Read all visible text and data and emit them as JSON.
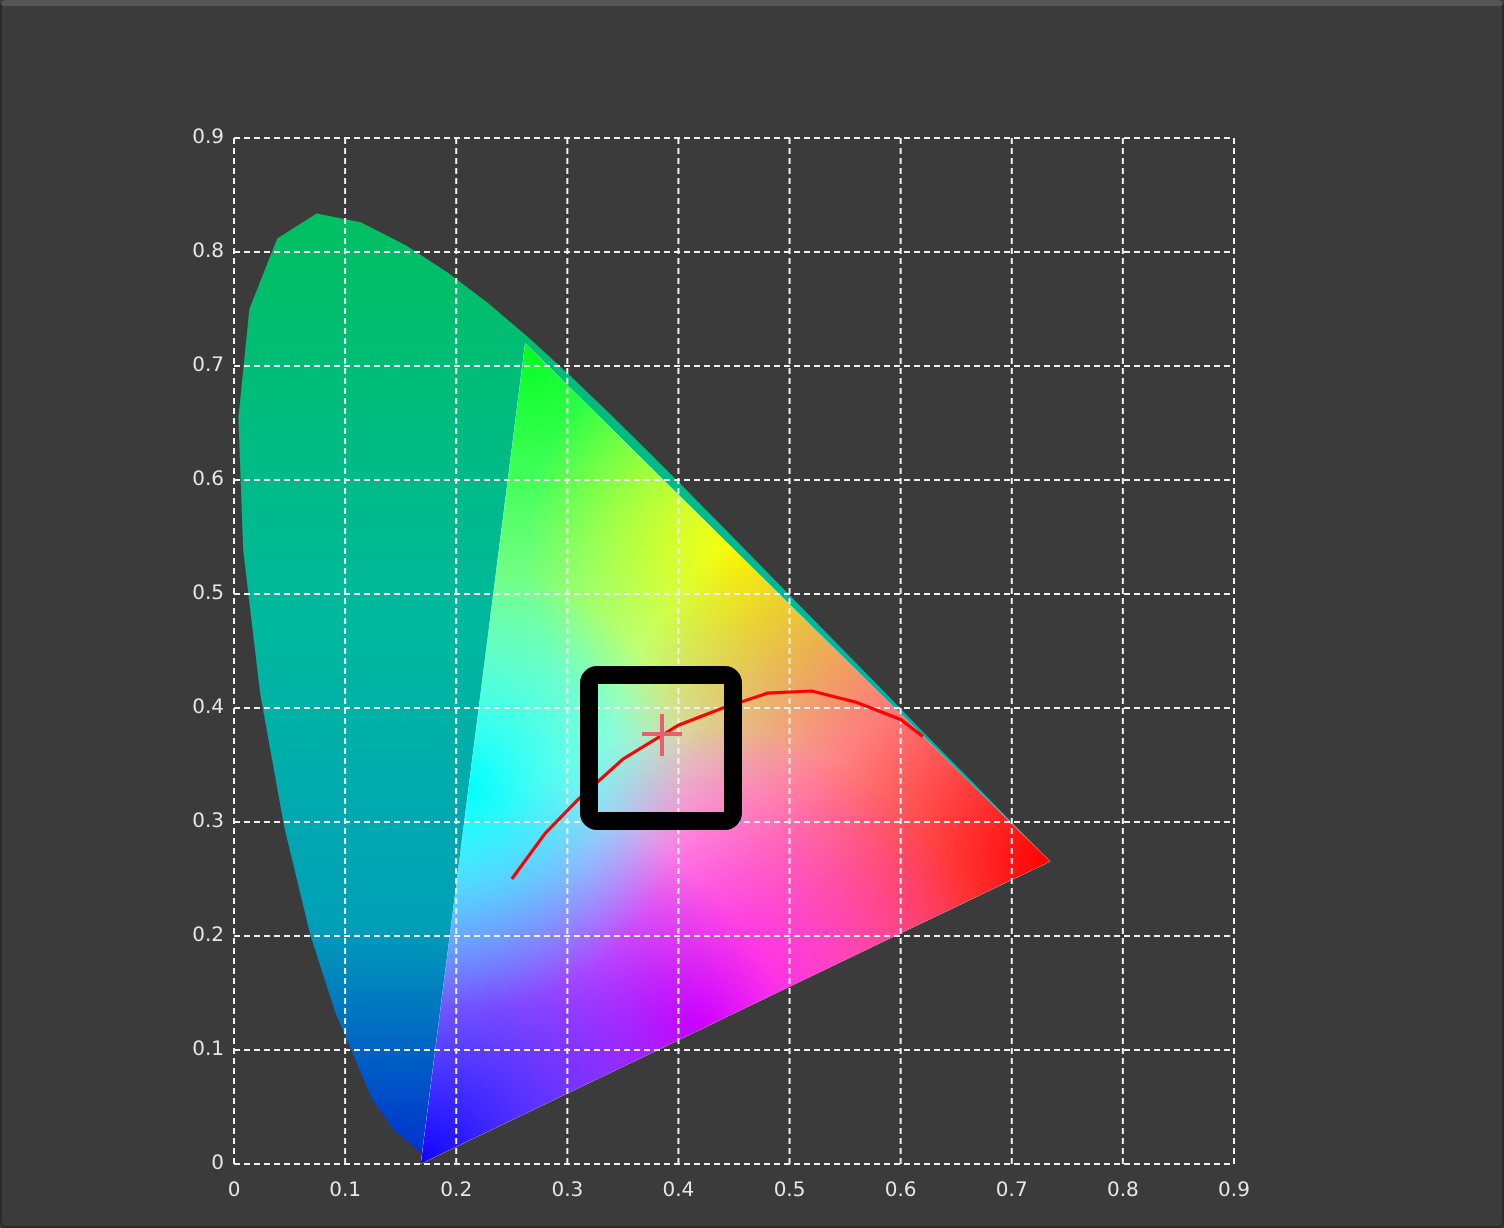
{
  "plot": {
    "chart_data": {
      "type": "line",
      "xlim": [
        0,
        0.9
      ],
      "ylim": [
        0,
        0.9
      ],
      "grid": true,
      "xticks": [
        0,
        0.1,
        0.2,
        0.3,
        0.4,
        0.5,
        0.6,
        0.7,
        0.8,
        0.9
      ],
      "yticks": [
        0,
        0.1,
        0.2,
        0.3,
        0.4,
        0.5,
        0.6,
        0.7,
        0.8,
        0.9
      ],
      "x": [
        0.25,
        0.28,
        0.31,
        0.35,
        0.4,
        0.44,
        0.48,
        0.52,
        0.56,
        0.6,
        0.62
      ],
      "series": [
        {
          "color": "#ff0000",
          "values": [
            0.25,
            0.29,
            0.32,
            0.355,
            0.385,
            0.4,
            0.413,
            0.415,
            0.405,
            0.39,
            0.375
          ]
        }
      ]
    }
  }
}
